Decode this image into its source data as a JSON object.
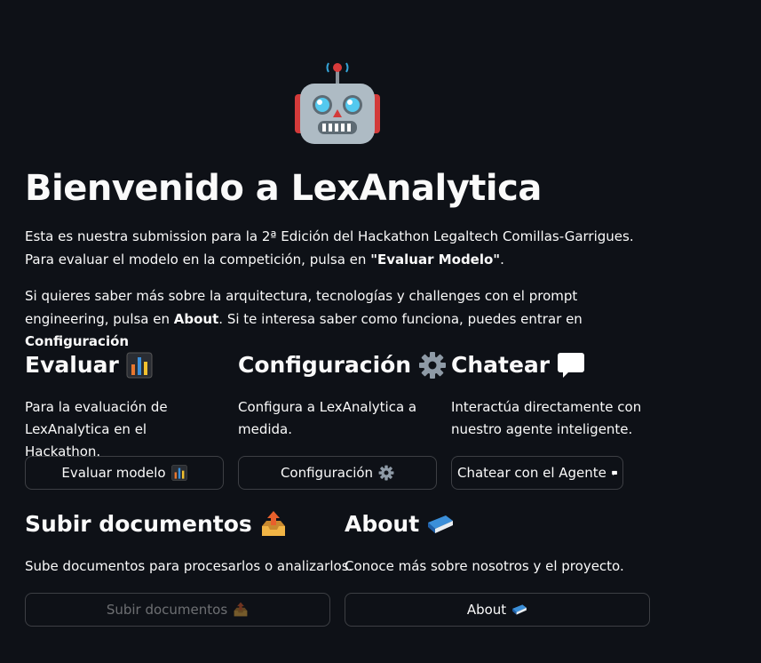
{
  "hero": {
    "title": "Bienvenido a LexAnalytica",
    "icon": "robot-icon"
  },
  "intro": {
    "p1_text": "Esta es nuestra submission para la 2ª Edición del Hackathon Legaltech Comillas-Garrigues. Para evaluar el modelo en la competición, pulsa en ",
    "p1_bold": "\"Evaluar Modelo\"",
    "p1_end": ".",
    "p2_text": "Si quieres saber más sobre la arquitectura, tecnologías y challenges con el prompt engineering, pulsa en ",
    "p2_bold1": "About",
    "p2_mid": ". Si te interesa saber como funciona, puedes entrar en ",
    "p2_bold2": "Configuración"
  },
  "sections": {
    "evaluar": {
      "title": "Evaluar",
      "icon": "bar-chart-icon",
      "description": "Para la evaluación de LexAnalytica en el Hackathon.",
      "button_label": "Evaluar modelo"
    },
    "configuracion": {
      "title": "Configuración",
      "icon": "gear-icon",
      "description": "Configura a LexAnalytica a medida.",
      "button_label": "Configuración"
    },
    "chatear": {
      "title": "Chatear",
      "icon": "speech-bubble-icon",
      "description": "Interactúa directamente con nuestro agente inteligente.",
      "button_label": "Chatear con el Agente"
    },
    "subir": {
      "title": "Subir documentos",
      "icon": "outbox-tray-icon",
      "description": "Sube documentos para procesarlos o analizarlos.",
      "button_label": "Subir documentos",
      "disabled": true
    },
    "about": {
      "title": "About",
      "icon": "book-icon",
      "description": "Conoce más sobre nosotros y el proyecto.",
      "button_label": "About"
    }
  },
  "colors": {
    "background": "#0e1117",
    "text": "#fafafa",
    "button_border": "rgba(250,250,250,0.2)"
  }
}
